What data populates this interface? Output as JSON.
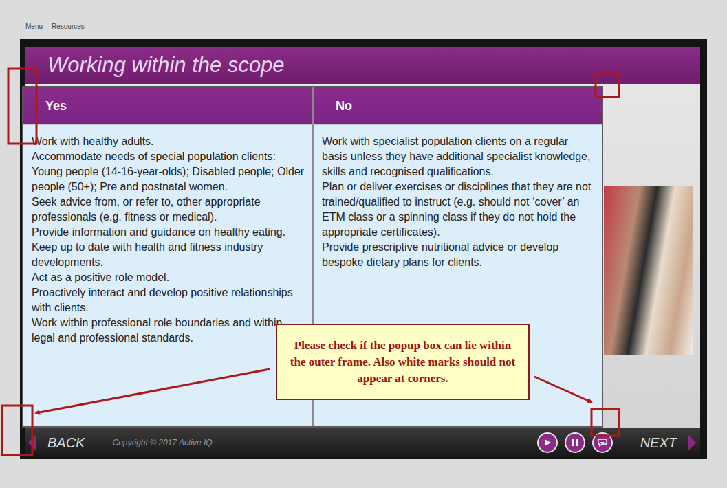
{
  "breadcrumbs": [
    "Menu",
    "Resources"
  ],
  "slide": {
    "title": "Working within the scope"
  },
  "popup": {
    "columns": [
      {
        "heading": "Yes",
        "items": [
          "Work with healthy adults.",
          "Accommodate needs of special population clients: Young people (14-16-year-olds); Disabled people; Older people (50+); Pre and postnatal women.",
          "Seek advice from, or refer to, other appropriate professionals (e.g. fitness or medical).",
          "Provide information and guidance on healthy eating.",
          "Keep up to date with health and fitness industry developments.",
          "Act as a positive role model.",
          "Proactively interact and develop positive relationships with clients.",
          "Work within professional role boundaries and within legal and professional standards."
        ]
      },
      {
        "heading": "No",
        "items": [
          "Work with specialist population clients on a regular basis unless they have additional specialist knowledge, skills and recognised qualifications.",
          "Plan or deliver exercises or disciplines that they are not trained/qualified to instruct (e.g. should not ‘cover’ an ETM class or a spinning class if they do not hold the appropriate certificates).",
          "Provide prescriptive nutritional advice or develop bespoke dietary plans for clients."
        ]
      }
    ]
  },
  "footer": {
    "back": "BACK",
    "copyright": "Copyright © 2017 Active IQ",
    "next": "NEXT"
  },
  "annotation": {
    "note": "Please check if the popup box can lie within the outer frame. Also white marks should not appear at corners."
  }
}
